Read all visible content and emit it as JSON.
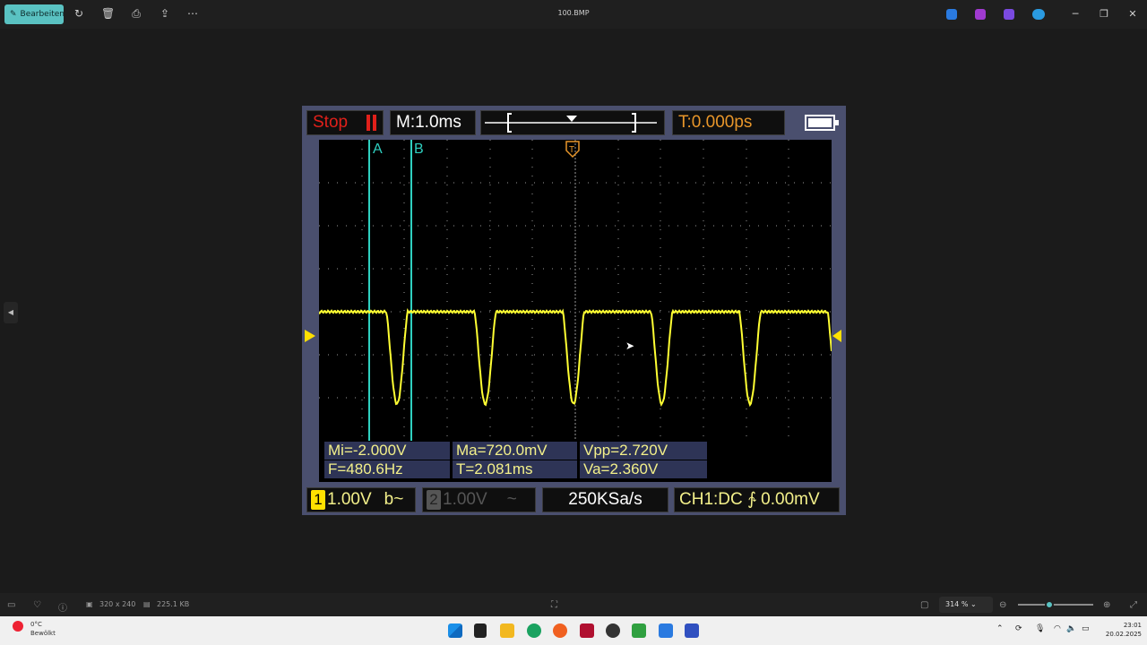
{
  "titlebar": {
    "edit_label": "Bearbeiten",
    "title": "100.BMP",
    "icons": [
      "rotate-icon",
      "trash-icon",
      "print-icon",
      "share-icon",
      "more-icon"
    ]
  },
  "scope": {
    "stop_label": "Stop",
    "timebase": "M:1.0ms",
    "trigger_time": "T:0.000ps",
    "cursor_a": "A",
    "cursor_b": "B",
    "trigger_marker": "T",
    "measurements": {
      "min": "Mi=-2.000V",
      "max": "Ma=720.0mV",
      "vpp": "Vpp=2.720V",
      "freq": "F=480.6Hz",
      "period": "T=2.081ms",
      "vavg": "Va=2.360V"
    },
    "ch1_num": "1",
    "ch1_scale": "1.00V",
    "ch1_bw": "b~",
    "ch2_num": "2",
    "ch2_scale": "1.00V",
    "ch2_coupling": "~",
    "sample_rate": "250KSa/s",
    "trigger_info": "CH1:DC ∱ 0.00mV",
    "colors": {
      "trace": "#ffff33",
      "cursor": "#2fd0c0",
      "stop": "#e0201a",
      "trigger": "#e8962a"
    }
  },
  "statusbar": {
    "dimensions": "320 x 240",
    "filesize": "225.1 KB",
    "zoom": "314 %"
  },
  "taskbar": {
    "weather_temp": "0°C",
    "weather_desc": "Bewölkt",
    "time": "23:01",
    "date": "20.02.2025"
  }
}
